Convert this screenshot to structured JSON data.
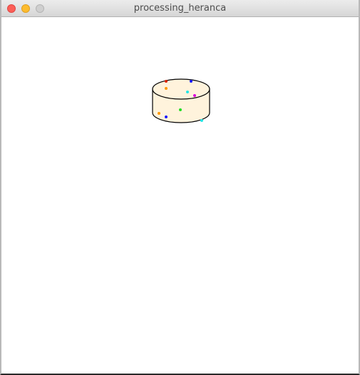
{
  "window": {
    "title": "processing_heranca"
  },
  "sketch": {
    "background": "#ffffff",
    "cylinder": {
      "fill": "#fff3dc",
      "stroke": "#000000"
    },
    "dots": [
      {
        "color": "#dd2200"
      },
      {
        "color": "#1a1aff"
      },
      {
        "color": "#ff9900"
      },
      {
        "color": "#22e5e5"
      },
      {
        "color": "#dd00dd"
      },
      {
        "color": "#22dd22"
      },
      {
        "color": "#ff9900"
      },
      {
        "color": "#1a1aff"
      },
      {
        "color": "#22e5e5"
      }
    ]
  }
}
